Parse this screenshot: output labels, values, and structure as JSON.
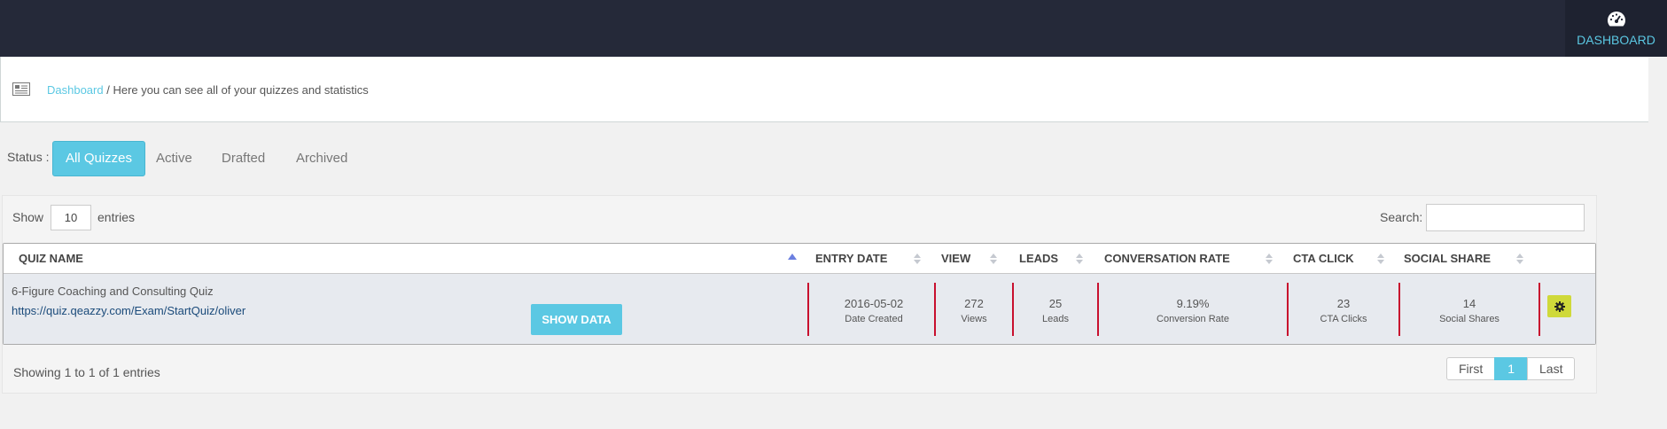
{
  "topbar": {
    "dashboard_icon": "gauge-icon",
    "dashboard_label": "DASHBOARD"
  },
  "breadcrumb": {
    "icon": "newspaper-icon",
    "link": "Dashboard",
    "text": " / Here you can see all of your quizzes and statistics"
  },
  "status": {
    "label": "Status :",
    "tabs": [
      "All Quizzes",
      "Active",
      "Drafted",
      "Archived"
    ],
    "active_tab": "All Quizzes"
  },
  "table_controls": {
    "show_label": "Show",
    "page_length": "10",
    "entries_label": "entries",
    "search_label": "Search:",
    "search_value": ""
  },
  "table": {
    "columns": [
      "QUIZ NAME",
      "ENTRY DATE",
      "VIEW",
      "LEADS",
      "CONVERSATION RATE",
      "CTA CLICK",
      "SOCIAL SHARE"
    ],
    "sorted_by": "QUIZ NAME",
    "rows": [
      {
        "name": "6-Figure Coaching and Consulting Quiz",
        "url": "https://quiz.qeazzy.com/Exam/StartQuiz/oliver",
        "show_data_label": "SHOW DATA",
        "entry_date": {
          "value": "2016-05-02",
          "label": "Date Created"
        },
        "views": {
          "value": "272",
          "label": "Views"
        },
        "leads": {
          "value": "25",
          "label": "Leads"
        },
        "conversion": {
          "value": "9.19%",
          "label": "Conversion Rate"
        },
        "cta": {
          "value": "23",
          "label": "CTA Clicks"
        },
        "shares": {
          "value": "14",
          "label": "Social Shares"
        },
        "settings_icon": "gear-icon"
      }
    ]
  },
  "footer": {
    "info": "Showing 1 to 1 of 1 entries",
    "pagination": {
      "first": "First",
      "current": "1",
      "last": "Last"
    }
  },
  "colors": {
    "topbar": "#252939",
    "accent": "#5bc8e3",
    "divider": "#c8102e",
    "gear_button": "#cfd93a"
  }
}
